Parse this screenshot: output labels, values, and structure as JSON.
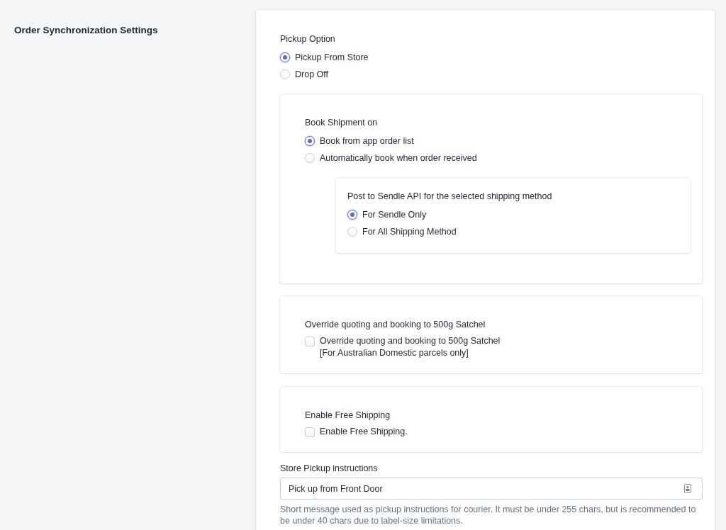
{
  "section_title": "Order Synchronization Settings",
  "pickup_option": {
    "label": "Pickup Option",
    "options": [
      {
        "label": "Pickup From Store",
        "selected": true
      },
      {
        "label": "Drop Off",
        "selected": false
      }
    ]
  },
  "book_shipment": {
    "label": "Book Shipment on",
    "options": [
      {
        "label": "Book from app order list",
        "selected": true
      },
      {
        "label": "Automatically book when order received",
        "selected": false
      }
    ]
  },
  "post_to_sendle": {
    "label": "Post to Sendle API for the selected shipping method",
    "options": [
      {
        "label": "For Sendle Only",
        "selected": true
      },
      {
        "label": "For All Shipping Method",
        "selected": false
      }
    ]
  },
  "override_satchel": {
    "heading": "Override quoting and booking to 500g Satchel",
    "checkbox": {
      "label": "Override quoting and booking to 500g Satchel",
      "note": "[For Australian Domestic parcels only]",
      "checked": false
    }
  },
  "free_shipping": {
    "heading": "Enable Free Shipping",
    "checkbox": {
      "label": "Enable Free Shipping.",
      "checked": false
    }
  },
  "store_pickup": {
    "label": "Store Pickup instructions",
    "value": "Pick up from Front Door",
    "help": "Short message used as pickup instructions for courier. It must be under 255 chars, but is recommended to be under 40 chars due to label-size limitations."
  }
}
